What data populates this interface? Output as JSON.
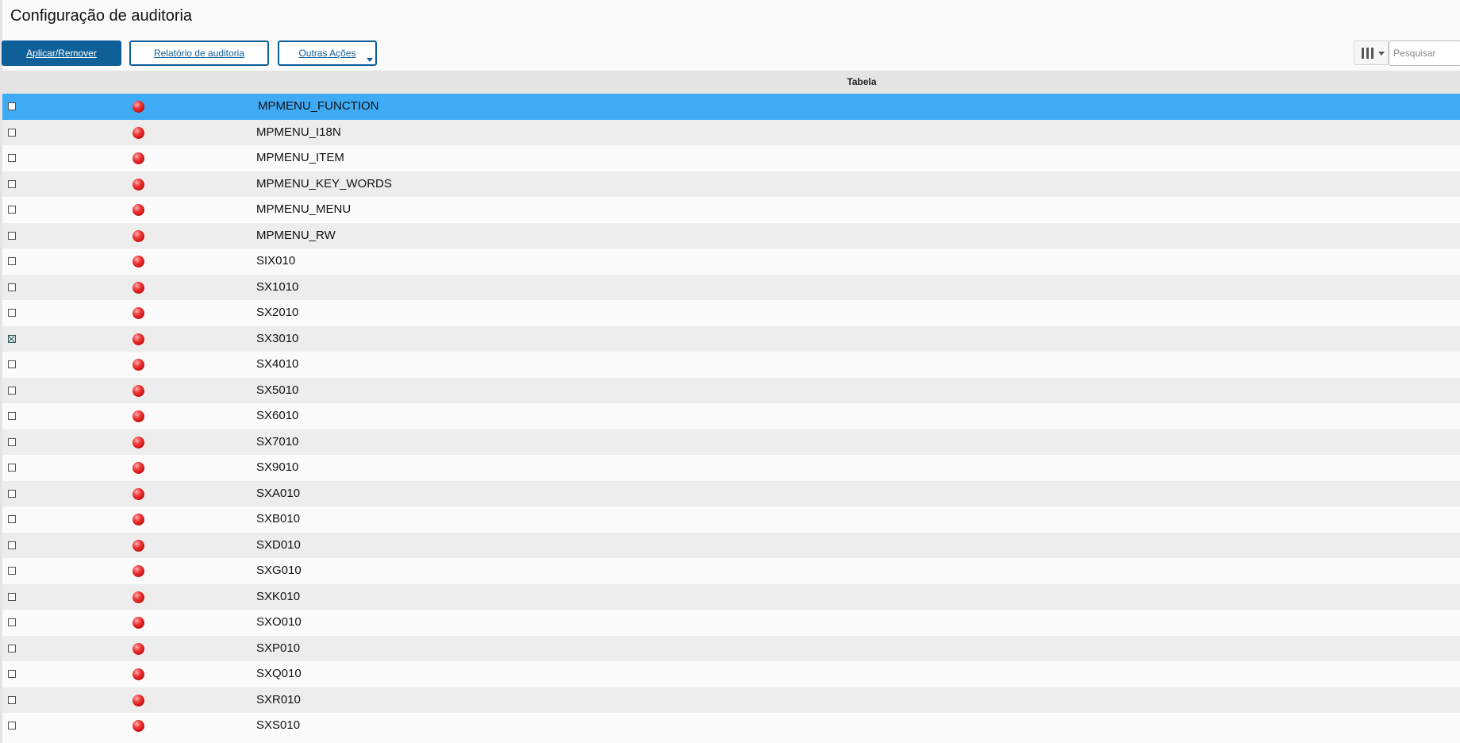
{
  "page": {
    "title": "Configuração de auditoria"
  },
  "toolbar": {
    "apply_label": "Aplicar/Remover",
    "report_label": "Relatório de auditoria",
    "more_label": "Outras Ações"
  },
  "search": {
    "placeholder": "Pesquisar",
    "value": ""
  },
  "grid": {
    "column_header": "Tabela",
    "rows": [
      {
        "name": "MPMENU_FUNCTION",
        "checked": false,
        "selected": true,
        "status": "red"
      },
      {
        "name": "MPMENU_I18N",
        "checked": false,
        "selected": false,
        "status": "red"
      },
      {
        "name": "MPMENU_ITEM",
        "checked": false,
        "selected": false,
        "status": "red"
      },
      {
        "name": "MPMENU_KEY_WORDS",
        "checked": false,
        "selected": false,
        "status": "red"
      },
      {
        "name": "MPMENU_MENU",
        "checked": false,
        "selected": false,
        "status": "red"
      },
      {
        "name": "MPMENU_RW",
        "checked": false,
        "selected": false,
        "status": "red"
      },
      {
        "name": "SIX010",
        "checked": false,
        "selected": false,
        "status": "red"
      },
      {
        "name": "SX1010",
        "checked": false,
        "selected": false,
        "status": "red"
      },
      {
        "name": "SX2010",
        "checked": false,
        "selected": false,
        "status": "red"
      },
      {
        "name": "SX3010",
        "checked": true,
        "selected": false,
        "status": "red"
      },
      {
        "name": "SX4010",
        "checked": false,
        "selected": false,
        "status": "red"
      },
      {
        "name": "SX5010",
        "checked": false,
        "selected": false,
        "status": "red"
      },
      {
        "name": "SX6010",
        "checked": false,
        "selected": false,
        "status": "red"
      },
      {
        "name": "SX7010",
        "checked": false,
        "selected": false,
        "status": "red"
      },
      {
        "name": "SX9010",
        "checked": false,
        "selected": false,
        "status": "red"
      },
      {
        "name": "SXA010",
        "checked": false,
        "selected": false,
        "status": "red"
      },
      {
        "name": "SXB010",
        "checked": false,
        "selected": false,
        "status": "red"
      },
      {
        "name": "SXD010",
        "checked": false,
        "selected": false,
        "status": "red"
      },
      {
        "name": "SXG010",
        "checked": false,
        "selected": false,
        "status": "red"
      },
      {
        "name": "SXK010",
        "checked": false,
        "selected": false,
        "status": "red"
      },
      {
        "name": "SXO010",
        "checked": false,
        "selected": false,
        "status": "red"
      },
      {
        "name": "SXP010",
        "checked": false,
        "selected": false,
        "status": "red"
      },
      {
        "name": "SXQ010",
        "checked": false,
        "selected": false,
        "status": "red"
      },
      {
        "name": "SXR010",
        "checked": false,
        "selected": false,
        "status": "red"
      },
      {
        "name": "SXS010",
        "checked": false,
        "selected": false,
        "status": "red"
      }
    ]
  },
  "colors": {
    "primary": "#0f5f98",
    "selected_row": "#40abf5",
    "row_alt": "#ededed",
    "status_red": "#e02424"
  },
  "icons": {
    "column_picker": "columns-icon",
    "status": "status-dot-icon",
    "dropdown": "caret-down-icon"
  }
}
